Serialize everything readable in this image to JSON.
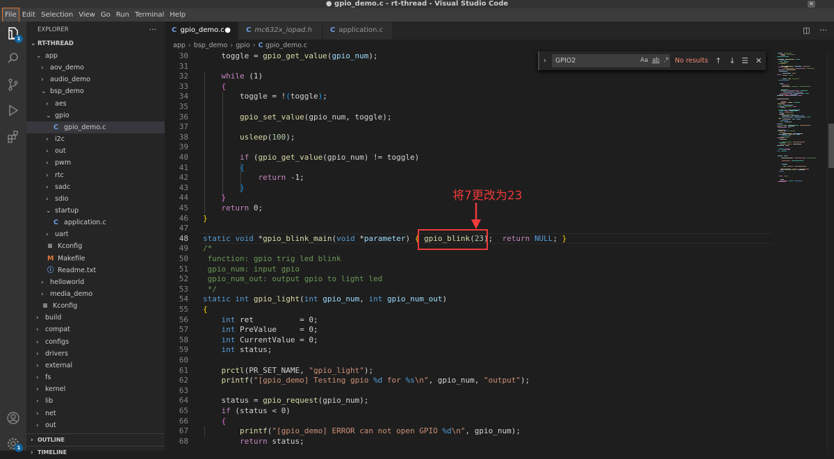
{
  "window": {
    "title": "● gpio_demo.c - rt-thread - Visual Studio Code"
  },
  "menu": [
    "File",
    "Edit",
    "Selection",
    "View",
    "Go",
    "Run",
    "Terminal",
    "Help"
  ],
  "activity": {
    "explorer_badge": "1",
    "settings_badge": "1"
  },
  "explorer": {
    "header": "EXPLORER",
    "more": "···",
    "root": "RT-THREAD",
    "items": [
      {
        "label": "app",
        "depth": 0,
        "kind": "folder-open"
      },
      {
        "label": "aov_demo",
        "depth": 1,
        "kind": "folder"
      },
      {
        "label": "audio_demo",
        "depth": 1,
        "kind": "folder"
      },
      {
        "label": "bsp_demo",
        "depth": 1,
        "kind": "folder-open"
      },
      {
        "label": "aes",
        "depth": 2,
        "kind": "folder"
      },
      {
        "label": "gpio",
        "depth": 2,
        "kind": "folder-open"
      },
      {
        "label": "gpio_demo.c",
        "depth": 3,
        "kind": "c",
        "selected": true
      },
      {
        "label": "i2c",
        "depth": 2,
        "kind": "folder"
      },
      {
        "label": "out",
        "depth": 2,
        "kind": "folder"
      },
      {
        "label": "pwm",
        "depth": 2,
        "kind": "folder"
      },
      {
        "label": "rtc",
        "depth": 2,
        "kind": "folder"
      },
      {
        "label": "sadc",
        "depth": 2,
        "kind": "folder"
      },
      {
        "label": "sdio",
        "depth": 2,
        "kind": "folder"
      },
      {
        "label": "startup",
        "depth": 2,
        "kind": "folder-open"
      },
      {
        "label": "application.c",
        "depth": 3,
        "kind": "c"
      },
      {
        "label": "uart",
        "depth": 2,
        "kind": "folder"
      },
      {
        "label": "Kconfig",
        "depth": 2,
        "kind": "kconfig"
      },
      {
        "label": "Makefile",
        "depth": 2,
        "kind": "makefile"
      },
      {
        "label": "Readme.txt",
        "depth": 2,
        "kind": "info"
      },
      {
        "label": "helloworld",
        "depth": 1,
        "kind": "folder"
      },
      {
        "label": "media_demo",
        "depth": 1,
        "kind": "folder"
      },
      {
        "label": "Kconfig",
        "depth": 1,
        "kind": "kconfig"
      },
      {
        "label": "build",
        "depth": 0,
        "kind": "folder"
      },
      {
        "label": "compat",
        "depth": 0,
        "kind": "folder"
      },
      {
        "label": "configs",
        "depth": 0,
        "kind": "folder"
      },
      {
        "label": "drivers",
        "depth": 0,
        "kind": "folder"
      },
      {
        "label": "external",
        "depth": 0,
        "kind": "folder"
      },
      {
        "label": "fs",
        "depth": 0,
        "kind": "folder"
      },
      {
        "label": "kernel",
        "depth": 0,
        "kind": "folder"
      },
      {
        "label": "lib",
        "depth": 0,
        "kind": "folder"
      },
      {
        "label": "net",
        "depth": 0,
        "kind": "folder"
      },
      {
        "label": "out",
        "depth": 0,
        "kind": "folder"
      }
    ],
    "sections": [
      "OUTLINE",
      "TIMELINE"
    ]
  },
  "tabs": [
    {
      "label": "gpio_demo.c",
      "active": true,
      "dirty_mark": "●"
    },
    {
      "label": "mc632x_iopad.h",
      "italic": true
    },
    {
      "label": "application.c"
    }
  ],
  "breadcrumb": [
    "app",
    "bsp_demo",
    "gpio",
    "gpio_demo.c"
  ],
  "find": {
    "query": "GPIO2",
    "options": [
      "Aa",
      "ab",
      ".*"
    ],
    "result": "No results"
  },
  "annotation": {
    "text": "将7更改为23",
    "color": "#f03a3a"
  },
  "editor": {
    "current_line": "48",
    "lines": [
      {
        "n": "30",
        "t": [
          [
            "    toggle = ",
            ""
          ],
          [
            "gpio_get_value",
            "fn"
          ],
          [
            "(",
            ""
          ],
          [
            "gpio_num",
            "vr"
          ],
          [
            ");",
            ""
          ]
        ]
      },
      {
        "n": "31",
        "t": []
      },
      {
        "n": "32",
        "t": [
          [
            "    ",
            ""
          ],
          [
            "while",
            "ctl"
          ],
          [
            " (1)",
            ""
          ]
        ]
      },
      {
        "n": "33",
        "t": [
          [
            "    ",
            ""
          ],
          [
            "{",
            "br2"
          ]
        ]
      },
      {
        "n": "34",
        "t": [
          [
            "        toggle = !",
            ""
          ],
          [
            "(",
            "br3"
          ],
          [
            "toggle",
            ""
          ],
          [
            ")",
            "br3"
          ],
          [
            ";",
            ""
          ]
        ]
      },
      {
        "n": "35",
        "t": []
      },
      {
        "n": "36",
        "t": [
          [
            "        ",
            ""
          ],
          [
            "gpio_set_value",
            "fn"
          ],
          [
            "(gpio_num, toggle);",
            ""
          ]
        ]
      },
      {
        "n": "37",
        "t": []
      },
      {
        "n": "38",
        "t": [
          [
            "        ",
            ""
          ],
          [
            "usleep",
            "fn"
          ],
          [
            "(",
            ""
          ],
          [
            "100",
            "nm"
          ],
          [
            ");",
            ""
          ]
        ]
      },
      {
        "n": "39",
        "t": []
      },
      {
        "n": "40",
        "t": [
          [
            "        ",
            ""
          ],
          [
            "if",
            "ctl"
          ],
          [
            " (",
            ""
          ],
          [
            "gpio_get_value",
            "fn"
          ],
          [
            "(gpio_num) != toggle)",
            ""
          ]
        ]
      },
      {
        "n": "41",
        "t": [
          [
            "        ",
            ""
          ],
          [
            "{",
            "br3"
          ]
        ]
      },
      {
        "n": "42",
        "t": [
          [
            "            ",
            ""
          ],
          [
            "return",
            "ctl"
          ],
          [
            " -1;",
            ""
          ]
        ]
      },
      {
        "n": "43",
        "t": [
          [
            "        ",
            ""
          ],
          [
            "}",
            "br3"
          ]
        ]
      },
      {
        "n": "44",
        "t": [
          [
            "    ",
            ""
          ],
          [
            "}",
            "br2"
          ]
        ]
      },
      {
        "n": "45",
        "t": [
          [
            "    ",
            ""
          ],
          [
            "return",
            "ctl"
          ],
          [
            " 0;",
            ""
          ]
        ]
      },
      {
        "n": "46",
        "t": [
          [
            "}",
            "br1"
          ]
        ]
      },
      {
        "n": "47",
        "t": []
      },
      {
        "n": "48",
        "t": [
          [
            "static",
            "kw"
          ],
          [
            " ",
            ""
          ],
          [
            "void",
            "kw"
          ],
          [
            " *",
            ""
          ],
          [
            "gpio_blink_main",
            "fn"
          ],
          [
            "(",
            ""
          ],
          [
            "void",
            "kw"
          ],
          [
            " *",
            ""
          ],
          [
            "parameter",
            "vr"
          ],
          [
            ") ",
            ""
          ],
          [
            "{",
            "br1"
          ],
          [
            " ",
            ""
          ],
          [
            "gpio_blink",
            "fn"
          ],
          [
            "(",
            ""
          ],
          [
            "23",
            "nm"
          ],
          [
            ");  ",
            ""
          ],
          [
            "return",
            "ctl"
          ],
          [
            " ",
            ""
          ],
          [
            "NULL",
            "mc"
          ],
          [
            "; ",
            ""
          ],
          [
            "}",
            "br1"
          ]
        ]
      },
      {
        "n": "49",
        "t": [
          [
            "/*",
            "cm"
          ]
        ]
      },
      {
        "n": "50",
        "t": [
          [
            " function: gpio trig led blink",
            "cm"
          ]
        ]
      },
      {
        "n": "51",
        "t": [
          [
            " gpio_num: input gpio",
            "cm"
          ]
        ]
      },
      {
        "n": "52",
        "t": [
          [
            " gpio_num_out: output gpio to light led",
            "cm"
          ]
        ]
      },
      {
        "n": "53",
        "t": [
          [
            " */",
            "cm"
          ]
        ]
      },
      {
        "n": "54",
        "t": [
          [
            "static",
            "kw"
          ],
          [
            " ",
            ""
          ],
          [
            "int",
            "kw"
          ],
          [
            " ",
            ""
          ],
          [
            "gpio_light",
            "fn"
          ],
          [
            "(",
            ""
          ],
          [
            "int",
            "kw"
          ],
          [
            " ",
            ""
          ],
          [
            "gpio_num",
            "vr"
          ],
          [
            ", ",
            ""
          ],
          [
            "int",
            "kw"
          ],
          [
            " ",
            ""
          ],
          [
            "gpio_num_out",
            "vr"
          ],
          [
            ")",
            ""
          ]
        ]
      },
      {
        "n": "55",
        "t": [
          [
            "{",
            "br1"
          ]
        ]
      },
      {
        "n": "56",
        "t": [
          [
            "    ",
            ""
          ],
          [
            "int",
            "kw"
          ],
          [
            " ret          = 0;",
            ""
          ]
        ]
      },
      {
        "n": "57",
        "t": [
          [
            "    ",
            ""
          ],
          [
            "int",
            "kw"
          ],
          [
            " PreValue     = 0;",
            ""
          ]
        ]
      },
      {
        "n": "58",
        "t": [
          [
            "    ",
            ""
          ],
          [
            "int",
            "kw"
          ],
          [
            " CurrentValue = 0;",
            ""
          ]
        ]
      },
      {
        "n": "59",
        "t": [
          [
            "    ",
            ""
          ],
          [
            "int",
            "kw"
          ],
          [
            " status;",
            ""
          ]
        ]
      },
      {
        "n": "60",
        "t": []
      },
      {
        "n": "61",
        "t": [
          [
            "    ",
            ""
          ],
          [
            "prctl",
            "fn"
          ],
          [
            "(PR_SET_NAME, ",
            ""
          ],
          [
            "\"gpio_light\"",
            "st"
          ],
          [
            ");",
            ""
          ]
        ]
      },
      {
        "n": "62",
        "t": [
          [
            "    ",
            ""
          ],
          [
            "printf",
            "fn"
          ],
          [
            "(",
            ""
          ],
          [
            "\"[gpio_demo] Testing gpio ",
            "st"
          ],
          [
            "%d",
            "kw"
          ],
          [
            " for ",
            "st"
          ],
          [
            "%s",
            "kw"
          ],
          [
            "\\n",
            "st"
          ],
          [
            "\"",
            "st"
          ],
          [
            ", gpio_num, ",
            ""
          ],
          [
            "\"output\"",
            "st"
          ],
          [
            ");",
            ""
          ]
        ]
      },
      {
        "n": "63",
        "t": []
      },
      {
        "n": "64",
        "t": [
          [
            "    status = ",
            ""
          ],
          [
            "gpio_request",
            "fn"
          ],
          [
            "(gpio_num);",
            ""
          ]
        ]
      },
      {
        "n": "65",
        "t": [
          [
            "    ",
            ""
          ],
          [
            "if",
            "ctl"
          ],
          [
            " (status < 0)",
            ""
          ]
        ]
      },
      {
        "n": "66",
        "t": [
          [
            "    ",
            ""
          ],
          [
            "{",
            "br2"
          ]
        ]
      },
      {
        "n": "67",
        "t": [
          [
            "        ",
            ""
          ],
          [
            "printf",
            "fn"
          ],
          [
            "(",
            ""
          ],
          [
            "\"[gpio_demo] ERROR can not open GPIO ",
            "st"
          ],
          [
            "%d",
            "kw"
          ],
          [
            "\\n",
            "st"
          ],
          [
            "\"",
            "st"
          ],
          [
            ", gpio_num);",
            ""
          ]
        ]
      },
      {
        "n": "68",
        "t": [
          [
            "        ",
            ""
          ],
          [
            "return",
            "ctl"
          ],
          [
            " status;",
            ""
          ]
        ]
      }
    ]
  }
}
